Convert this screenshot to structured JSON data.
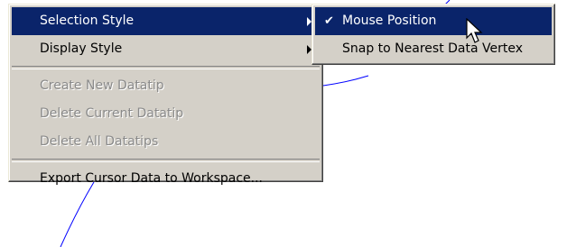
{
  "main_menu": {
    "items": [
      {
        "label": "Selection Style",
        "state": "highlighted",
        "has_submenu": true
      },
      {
        "label": "Display Style",
        "state": "normal",
        "has_submenu": true
      },
      {
        "label": "Create New Datatip",
        "state": "disabled",
        "has_submenu": false
      },
      {
        "label": "Delete Current Datatip",
        "state": "disabled",
        "has_submenu": false
      },
      {
        "label": "Delete All Datatips",
        "state": "disabled",
        "has_submenu": false
      },
      {
        "label": "Export Cursor Data to Workspace...",
        "state": "normal",
        "has_submenu": false
      }
    ]
  },
  "sub_menu": {
    "items": [
      {
        "label": "Mouse Position",
        "state": "highlighted",
        "checked": true,
        "check_glyph": "✔"
      },
      {
        "label": "Snap to Nearest Data Vertex",
        "state": "normal",
        "checked": false,
        "check_glyph": ""
      }
    ]
  },
  "colors": {
    "menu_bg": "#d4d0c8",
    "highlight_bg": "#0a246a",
    "highlight_text": "#ffffff",
    "disabled_text": "#8a8a8a",
    "curve": "#0000ff"
  },
  "icons": {
    "submenu_arrow": "arrow-right-icon",
    "check": "check-icon",
    "cursor": "mouse-pointer-icon"
  }
}
